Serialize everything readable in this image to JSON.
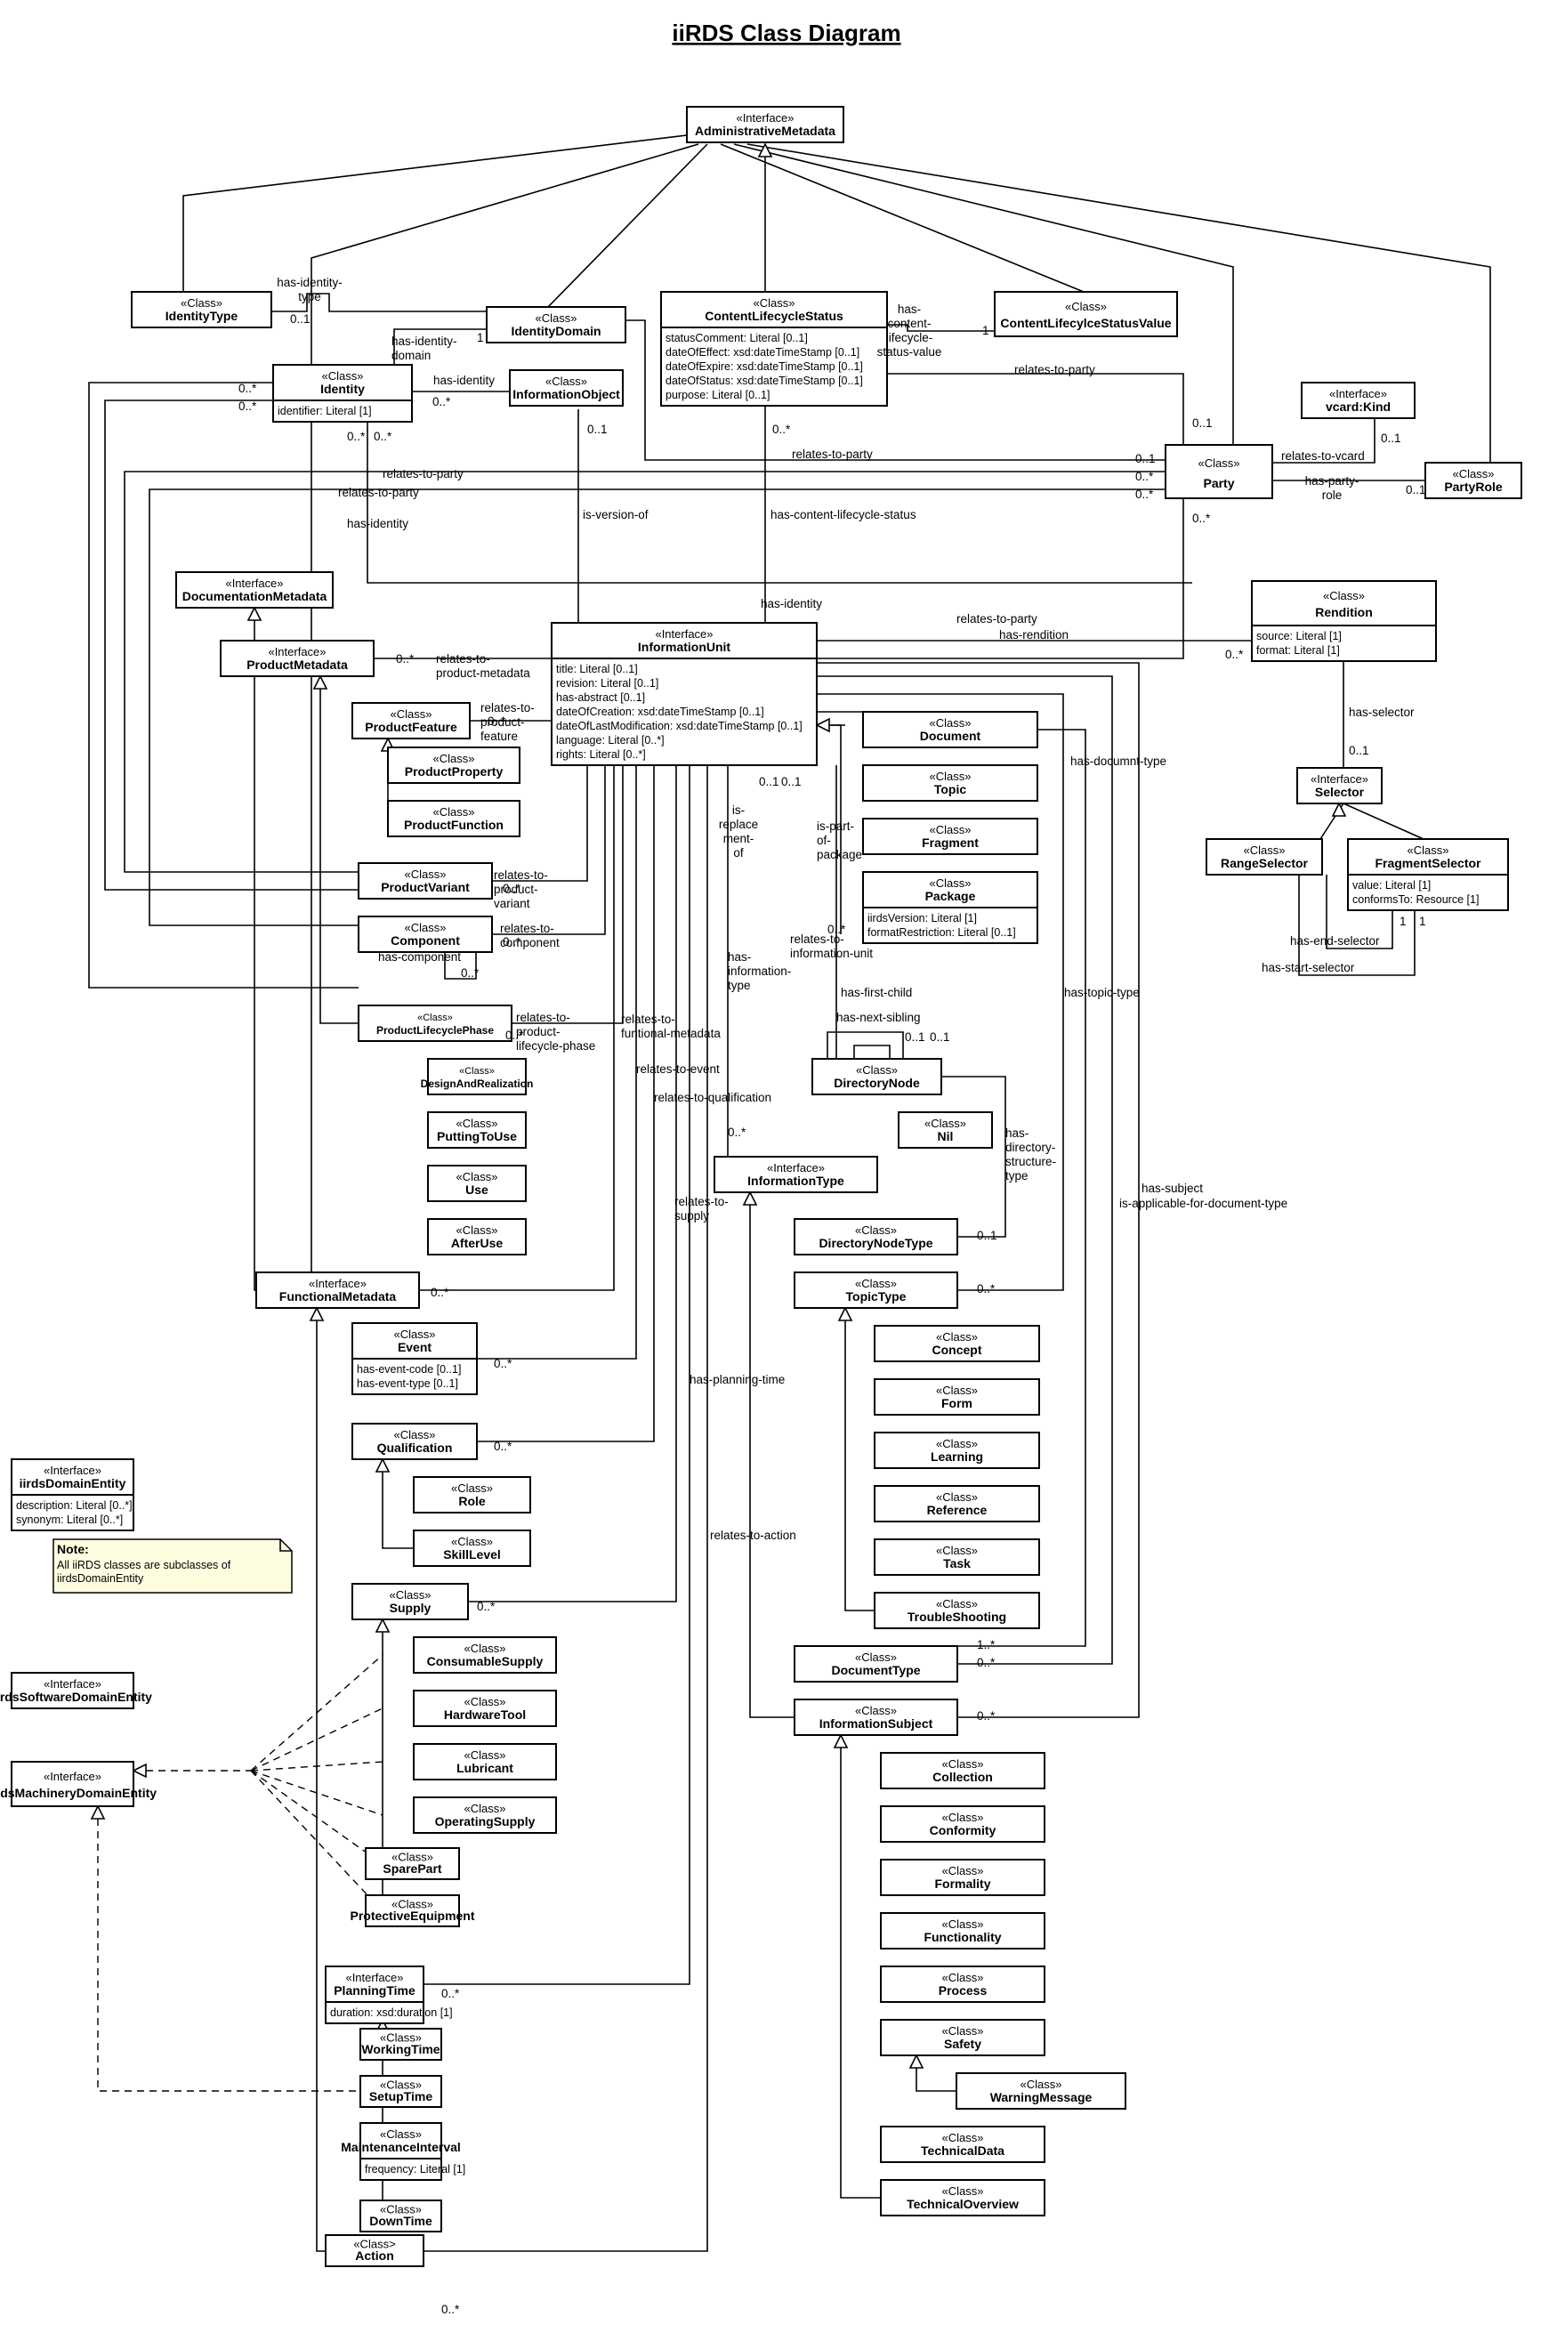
{
  "title": "iiRDS Class Diagram",
  "classes": {
    "administrative_metadata": {
      "stereotype": "«Interface»",
      "name": "AdministrativeMetadata"
    },
    "identity_type": {
      "stereotype": "«Class»",
      "name": "IdentityType"
    },
    "identity_domain": {
      "stereotype": "«Class»",
      "name": "IdentityDomain"
    },
    "content_lifecycle_status": {
      "stereotype": "«Class»",
      "name": "ContentLifecycleStatus",
      "attributes": [
        "statusComment: Literal [0..1]",
        "dateOfEffect: xsd:dateTimeStamp [0..1]",
        "dateOfExpire: xsd:dateTimeStamp [0..1]",
        "dateOfStatus: xsd:dateTimeStamp [0..1]",
        "purpose: Literal [0..1]"
      ]
    },
    "content_lifecycle_status_value": {
      "stereotype": "«Class»",
      "name": "ContentLifecylceStatusValue"
    },
    "identity": {
      "stereotype": "«Class»",
      "name": "Identity",
      "attributes": [
        "identifier: Literal [1]"
      ]
    },
    "information_object": {
      "stereotype": "«Class»",
      "name": "InformationObject"
    },
    "vcard_kind": {
      "stereotype": "«Interface»",
      "name": "vcard:Kind"
    },
    "party": {
      "stereotype": "«Class»",
      "name": "Party"
    },
    "party_role": {
      "stereotype": "«Class»",
      "name": "PartyRole"
    },
    "documentation_metadata": {
      "stereotype": "«Interface»",
      "name": "DocumentationMetadata"
    },
    "product_metadata": {
      "stereotype": "«Interface»",
      "name": "ProductMetadata"
    },
    "information_unit": {
      "stereotype": "«Interface»",
      "name": "InformationUnit",
      "attributes": [
        "title: Literal [0..1]",
        "revision: Literal [0..1]",
        "has-abstract [0..1]",
        "dateOfCreation: xsd:dateTimeStamp [0..1]",
        "dateOfLastModification: xsd:dateTimeStamp [0..1]",
        "language: Literal [0..*]",
        "rights: Literal [0..*]"
      ]
    },
    "rendition": {
      "stereotype": "«Class»",
      "name": "Rendition",
      "attributes": [
        "source: Literal [1]",
        "format: Literal [1]"
      ]
    },
    "selector": {
      "stereotype": "«Interface»",
      "name": "Selector"
    },
    "range_selector": {
      "stereotype": "«Class»",
      "name": "RangeSelector"
    },
    "fragment_selector": {
      "stereotype": "«Class»",
      "name": "FragmentSelector",
      "attributes": [
        "value: Literal [1]",
        "conformsTo: Resource [1]"
      ]
    },
    "product_feature": {
      "stereotype": "«Class»",
      "name": "ProductFeature"
    },
    "product_property": {
      "stereotype": "«Class»",
      "name": "ProductProperty"
    },
    "product_function": {
      "stereotype": "«Class»",
      "name": "ProductFunction"
    },
    "product_variant": {
      "stereotype": "«Class»",
      "name": "ProductVariant"
    },
    "component": {
      "stereotype": "«Class»",
      "name": "Component"
    },
    "product_lifecycle_phase": {
      "stereotype": "«Class»",
      "name": "ProductLifecyclePhase"
    },
    "design_and_realization": {
      "stereotype": "«Class»",
      "name": "DesignAndRealization"
    },
    "putting_to_use": {
      "stereotype": "«Class»",
      "name": "PuttingToUse"
    },
    "use": {
      "stereotype": "«Class»",
      "name": "Use"
    },
    "after_use": {
      "stereotype": "«Class»",
      "name": "AfterUse"
    },
    "document": {
      "stereotype": "«Class»",
      "name": "Document"
    },
    "topic": {
      "stereotype": "«Class»",
      "name": "Topic"
    },
    "fragment": {
      "stereotype": "«Class»",
      "name": "Fragment"
    },
    "package": {
      "stereotype": "«Class»",
      "name": "Package",
      "attributes": [
        "iirdsVersion: Literal [1]",
        "formatRestriction: Literal [0..1]"
      ]
    },
    "directory_node": {
      "stereotype": "«Class»",
      "name": "DirectoryNode"
    },
    "nil": {
      "stereotype": "«Class»",
      "name": "Nil"
    },
    "information_type": {
      "stereotype": "«Interface»",
      "name": "InformationType"
    },
    "directory_node_type": {
      "stereotype": "«Class»",
      "name": "DirectoryNodeType"
    },
    "topic_type": {
      "stereotype": "«Class»",
      "name": "TopicType"
    },
    "concept": {
      "stereotype": "«Class»",
      "name": "Concept"
    },
    "form": {
      "stereotype": "«Class»",
      "name": "Form"
    },
    "learning": {
      "stereotype": "«Class»",
      "name": "Learning"
    },
    "reference": {
      "stereotype": "«Class»",
      "name": "Reference"
    },
    "task": {
      "stereotype": "«Class»",
      "name": "Task"
    },
    "trouble_shooting": {
      "stereotype": "«Class»",
      "name": "TroubleShooting"
    },
    "document_type": {
      "stereotype": "«Class»",
      "name": "DocumentType"
    },
    "information_subject": {
      "stereotype": "«Class»",
      "name": "InformationSubject"
    },
    "collection": {
      "stereotype": "«Class»",
      "name": "Collection"
    },
    "conformity": {
      "stereotype": "«Class»",
      "name": "Conformity"
    },
    "formality": {
      "stereotype": "«Class»",
      "name": "Formality"
    },
    "functionality": {
      "stereotype": "«Class»",
      "name": "Functionality"
    },
    "process": {
      "stereotype": "«Class»",
      "name": "Process"
    },
    "safety": {
      "stereotype": "«Class»",
      "name": "Safety"
    },
    "warning_message": {
      "stereotype": "«Class»",
      "name": "WarningMessage"
    },
    "technical_data": {
      "stereotype": "«Class»",
      "name": "TechnicalData"
    },
    "technical_overview": {
      "stereotype": "«Class»",
      "name": "TechnicalOverview"
    },
    "functional_metadata": {
      "stereotype": "«Interface»",
      "name": "FunctionalMetadata"
    },
    "event": {
      "stereotype": "«Class»",
      "name": "Event",
      "attributes": [
        "has-event-code [0..1]",
        "has-event-type [0..1]"
      ]
    },
    "qualification": {
      "stereotype": "«Class»",
      "name": "Qualification"
    },
    "role": {
      "stereotype": "«Class»",
      "name": "Role"
    },
    "skill_level": {
      "stereotype": "«Class»",
      "name": "SkillLevel"
    },
    "supply": {
      "stereotype": "«Class»",
      "name": "Supply"
    },
    "consumable_supply": {
      "stereotype": "«Class»",
      "name": "ConsumableSupply"
    },
    "hardware_tool": {
      "stereotype": "«Class»",
      "name": "HardwareTool"
    },
    "lubricant": {
      "stereotype": "«Class»",
      "name": "Lubricant"
    },
    "operating_supply": {
      "stereotype": "«Class»",
      "name": "OperatingSupply"
    },
    "spare_part": {
      "stereotype": "«Class»",
      "name": "SparePart"
    },
    "protective_equipment": {
      "stereotype": "«Class»",
      "name": "ProtectiveEquipment"
    },
    "planning_time": {
      "stereotype": "«Interface»",
      "name": "PlanningTime",
      "attributes": [
        "duration: xsd:duration [1]"
      ]
    },
    "working_time": {
      "stereotype": "«Class»",
      "name": "WorkingTime"
    },
    "setup_time": {
      "stereotype": "«Class»",
      "name": "SetupTime"
    },
    "maintenance_interval": {
      "stereotype": "«Class»",
      "name": "MaintenanceInterval",
      "attributes": [
        "frequency: Literal [1]"
      ]
    },
    "down_time": {
      "stereotype": "«Class»",
      "name": "DownTime"
    },
    "action": {
      "stereotype": "«Class>",
      "name": "Action"
    },
    "iirds_domain_entity": {
      "stereotype": "«Interface»",
      "name": "iirdsDomainEntity",
      "attributes": [
        "description: Literal [0..*]",
        "synonym: Literal [0..*]"
      ]
    },
    "iirds_software_domain_entity": {
      "stereotype": "«Interface»",
      "name": "iirdsSoftwareDomainEntity"
    },
    "iirds_machinery_domain_entity": {
      "stereotype": "«Interface»",
      "name": "iirdsMachineryDomainEntity"
    }
  },
  "note": {
    "heading": "Note:",
    "lines": [
      "All iiRDS classes are subclasses of",
      "iirdsDomainEntity"
    ]
  },
  "labels": {
    "has_identity_type": [
      "has-identity-",
      "type"
    ],
    "has_identity_domain": [
      "has-identity-",
      "domain"
    ],
    "has_identity": "has-identity",
    "has_content_lifecycle_status_value": [
      "has-",
      "content-",
      "lifecycle-",
      "status-value"
    ],
    "relates_to_party": "relates-to-party",
    "relates_to_vcard": "relates-to-vcard",
    "has_party_role": [
      "has-party-",
      "role"
    ],
    "is_version_of": "is-version-of",
    "has_content_lifecycle_status": "has-content-lifecycle-status",
    "has_rendition": "has-rendition",
    "has_selector": "has-selector",
    "has_end_selector": "has-end-selector",
    "has_start_selector": "has-start-selector",
    "relates_to_product_metadata": [
      "relates-to-",
      "product-metadata"
    ],
    "relates_to_product_feature": [
      "relates-to-",
      "product-",
      "feature"
    ],
    "relates_to_product_variant": [
      "relates-to-",
      "product-",
      "variant"
    ],
    "relates_to_component": [
      "relates-to-",
      "component"
    ],
    "has_component": "has-component",
    "relates_to_product_lifecycle_phase": [
      "relates-to-",
      "product-",
      "lifecycle-phase"
    ],
    "relates_to_functional_metadata": [
      "relates-to-",
      "funtional-metadata"
    ],
    "relates_to_event": "relates-to-event",
    "relates_to_qualification": "relates-to-qualification",
    "relates_to_supply": [
      "relates-to-",
      "supply"
    ],
    "has_planning_time": "has-planning-time",
    "relates_to_action": "relates-to-action",
    "is_replacement_of": [
      "is-",
      "replace",
      "ment-",
      "of"
    ],
    "is_part_of_package": [
      "is-part-",
      "of-",
      "package"
    ],
    "relates_to_information_unit": [
      "relates-to-",
      "information-unit"
    ],
    "has_information_type": [
      "has-",
      "information-",
      "type"
    ],
    "has_first_child": "has-first-child",
    "has_next_sibling": "has-next-sibling",
    "has_directory_structure_type": [
      "has-",
      "directory-",
      "structure-",
      "type"
    ],
    "has_document_type": "has-documnt-type",
    "has_topic_type": "has-topic-type",
    "has_subject": "has-subject",
    "is_applicable_for_document_type": "is-applicable-for-document-type"
  },
  "multiplicities": {
    "m_0_1": "0..1",
    "m_1": "1",
    "m_0_many": "0..*",
    "m_1_many": "1..*"
  }
}
